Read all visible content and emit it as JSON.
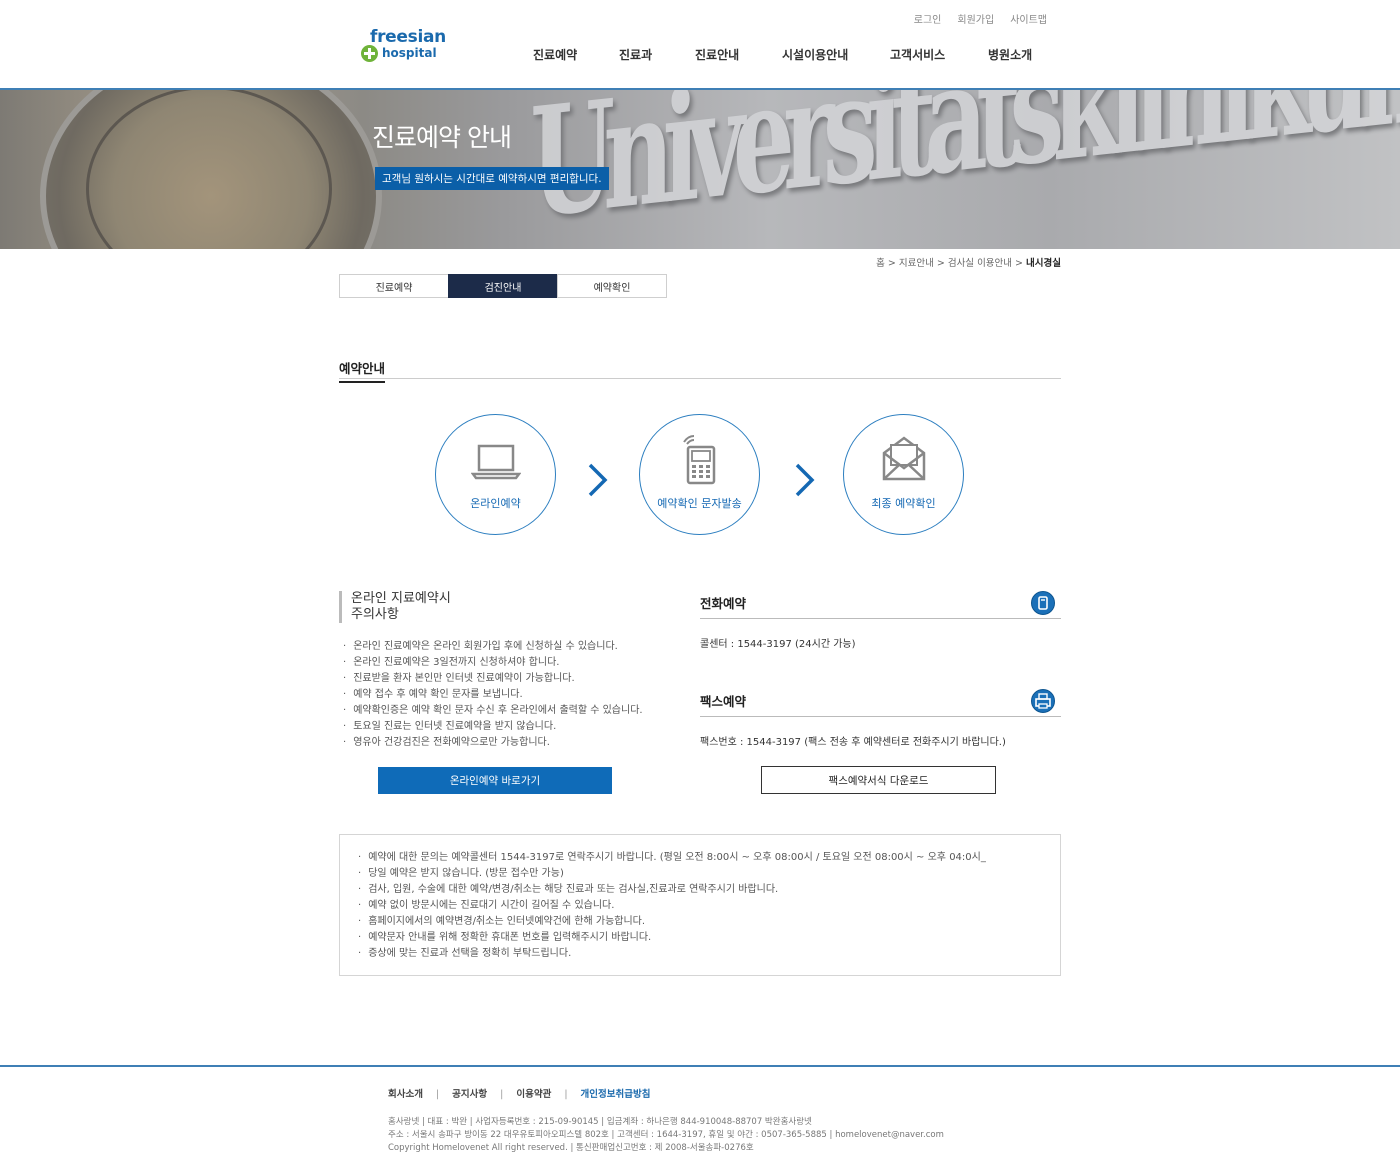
{
  "header": {
    "util_links": [
      "로그인",
      "회원가입",
      "사이트맵"
    ],
    "logo": {
      "line1": "freesian",
      "line2": "hospital"
    },
    "gnb": [
      "진료예약",
      "진료과",
      "진료안내",
      "시설이용안내",
      "고객서비스",
      "병원소개"
    ]
  },
  "banner": {
    "title": "진료예약 안내",
    "subtitle": "고객님 원하시는 시간대로 예약하시면 편리합니다.",
    "watermark": "Universitätsklinikum Ulm"
  },
  "breadcrumb": {
    "path": "홈 > 지료안내 > 검사실 이용안내 > ",
    "current": "내시경실"
  },
  "tabs": [
    {
      "label": "진료예약",
      "active": false
    },
    {
      "label": "검진안내",
      "active": true
    },
    {
      "label": "예약확인",
      "active": false
    }
  ],
  "section_title": "예약안내",
  "steps": [
    {
      "label": "온라인예약",
      "icon": "laptop-icon"
    },
    {
      "label": "예약확인 문자발송",
      "icon": "mobile-phone-icon"
    },
    {
      "label": "최종 예약확인",
      "icon": "envelope-icon"
    }
  ],
  "notes_left": {
    "heading_line1": "온라인 지료예약시",
    "heading_line2": "주의사항",
    "items": [
      "온라인 진료예약은 온라인 회원가입 후에 신청하실 수 있습니다.",
      "온라인 진료예약은 3일전까지 신청하셔야 합니다.",
      "진료받을 환자 본인만 인터넷 진료예약이 가능합니다.",
      "예약 접수 후 예약 확인 문자를 보냅니다.",
      "예약확인증은 예약 확인 문자 수신 후 온라인에서 출력할 수 있습니다.",
      "토요일 진료는 인터넷 진료예약을 받지 않습니다.",
      "영유아 건강검진은 전화예약으로만 가능합니다."
    ],
    "button": "온라인예약 바로가기"
  },
  "phone": {
    "title": "전화예약",
    "icon": "phone-icon",
    "text": "콜센터 : 1544-3197  (24시간 가능)"
  },
  "fax": {
    "title": "팩스예약",
    "icon": "fax-icon",
    "text": "팩스번호 : 1544-3197  (팩스 전송 후 예약센터로 전화주시기 바랍니다.)",
    "button": "팩스예약서식 다운로드"
  },
  "info_box": [
    "예약에 대한 문의는 예약콜센터 1544-3197로 연락주시기 바랍니다. (평일 오전 8:00시 ~ 오후 08:00시 / 토요일 오전 08:00시 ~ 오후 04:0시_",
    "당일 예약은 받지 않습니다. (방문 접수만 가능)",
    "검사, 입원, 수술에 대한 예약/변경/취소는 해당 진료과 또는 검사실,진료과로 연락주시기 바랍니다.",
    "예약 없이 방문시에는 진료대기 시간이 길어질 수 있습니다.",
    "홈페이지에서의 예약변경/취소는 인터넷예약건에 한해 가능합니다.",
    "예약문자 안내를 위해 정확한 휴대폰 번호를 입력해주시기 바랍니다.",
    "증상에 맞는 진료과 선택을 정확히 부탁드립니다."
  ],
  "footer": {
    "links": [
      "회사소개",
      "공지사항",
      "이용약관",
      "개인정보취급방침"
    ],
    "sep": "|",
    "info": [
      "홈사랑넷  |  대표 : 박완  |  사업자등록번호 : 215-09-90145  |  입금계좌 : 하나은행 844-910048-88707 박완홈사랑넷",
      "주소 : 서울시 송파구 방이동 22 대우유토피아오피스텔 802호  |  고객센터 : 1644-3197, 휴일 및 야간 : 0507-365-5885  |  homelovenet@naver.com",
      "Copyright Homelovenet All right reserved.   |  통신판매업신고번호 : 제 2008-서울송파-0276호"
    ]
  },
  "colors": {
    "brand_blue": "#1b6aad",
    "accent_blue": "#0f6bb8",
    "active_tab": "#1c2b49",
    "logo_green": "#6fb33a"
  }
}
